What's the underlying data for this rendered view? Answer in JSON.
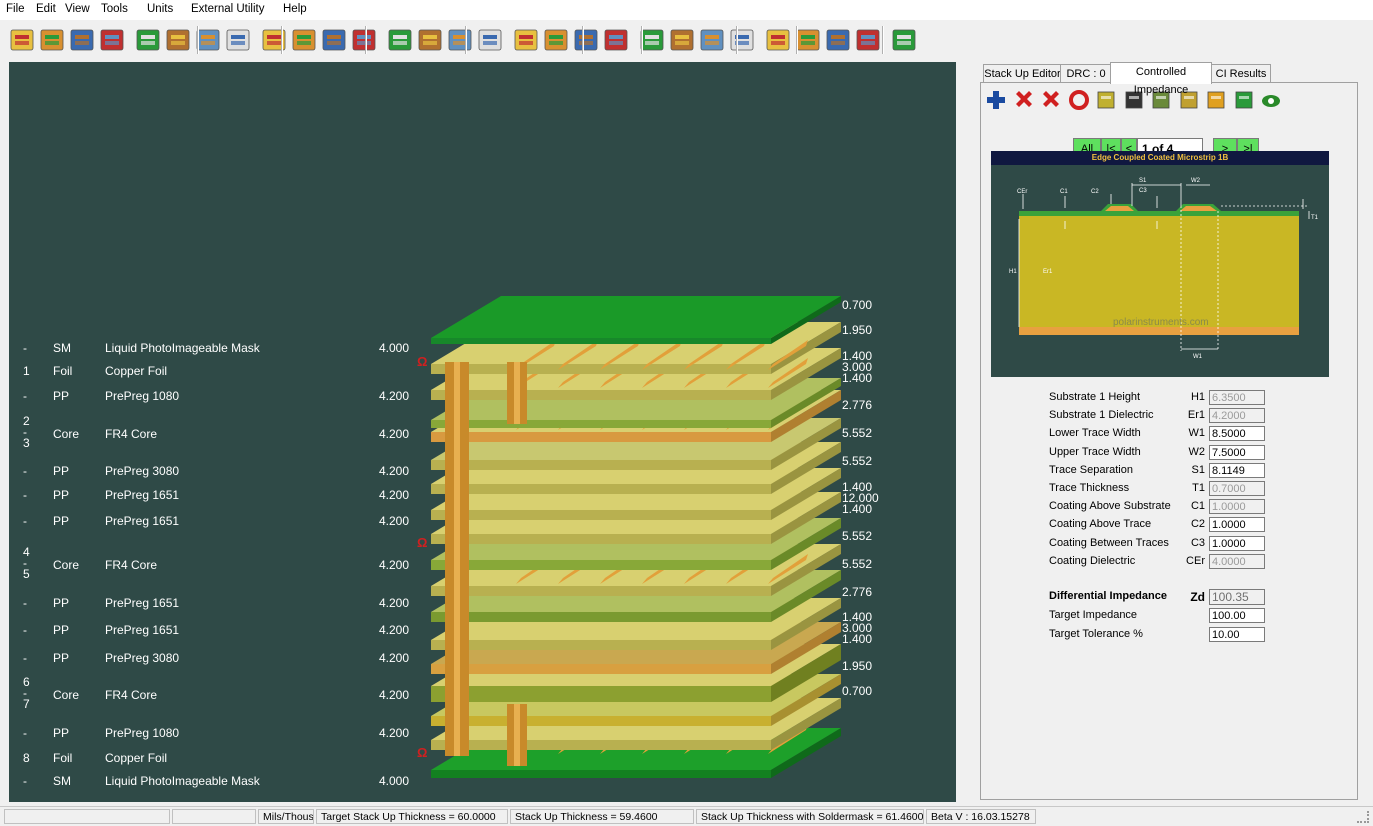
{
  "menu": [
    "File",
    "Edit",
    "View",
    "Tools",
    "Units",
    "External Utility",
    "Help"
  ],
  "tabs": [
    "Stack Up Editor",
    "DRC : 0",
    "Controlled Impedance",
    "CI Results"
  ],
  "nav": {
    "all": "All",
    "first": "|<",
    "prev": "<",
    "page": "1 of 4",
    "next": ">",
    "last": ">|"
  },
  "diagram": {
    "title": "Edge Coupled Coated Microstrip 1B",
    "watermark": "polarinstruments.com",
    "labels": {
      "s1": "S1",
      "w2": "W2",
      "c3": "C3",
      "cer": "CEr",
      "c1": "C1",
      "c2": "C2",
      "t1": "T1",
      "h1": "H1",
      "er1": "Er1",
      "w1": "W1"
    }
  },
  "layers": [
    {
      "num": "-",
      "type": "SM",
      "name": "Liquid PhotoImageable Mask",
      "er": "4.000"
    },
    {
      "num": "1",
      "type": "Foil",
      "name": "Copper Foil",
      "er": ""
    },
    {
      "num": "-",
      "type": "PP",
      "name": "PrePreg 1080",
      "er": "4.200"
    },
    {
      "num": "2\n-\n3",
      "type": "Core",
      "name": "FR4 Core",
      "er": "4.200"
    },
    {
      "num": "-",
      "type": "PP",
      "name": "PrePreg 3080",
      "er": "4.200"
    },
    {
      "num": "-",
      "type": "PP",
      "name": "PrePreg 1651",
      "er": "4.200"
    },
    {
      "num": "-",
      "type": "PP",
      "name": "PrePreg 1651",
      "er": "4.200"
    },
    {
      "num": "4\n-\n5",
      "type": "Core",
      "name": "FR4 Core",
      "er": "4.200"
    },
    {
      "num": "-",
      "type": "PP",
      "name": "PrePreg 1651",
      "er": "4.200"
    },
    {
      "num": "-",
      "type": "PP",
      "name": "PrePreg 1651",
      "er": "4.200"
    },
    {
      "num": "-",
      "type": "PP",
      "name": "PrePreg 3080",
      "er": "4.200"
    },
    {
      "num": "6\n-\n7",
      "type": "Core",
      "name": "FR4 Core",
      "er": "4.200"
    },
    {
      "num": "-",
      "type": "PP",
      "name": "PrePreg 1080",
      "er": "4.200"
    },
    {
      "num": "8",
      "type": "Foil",
      "name": "Copper Foil",
      "er": ""
    },
    {
      "num": "-",
      "type": "SM",
      "name": "Liquid PhotoImageable Mask",
      "er": "4.000"
    }
  ],
  "omega_symbol": "Ω",
  "thickness_labels": [
    "0.700",
    "1.950",
    "1.400",
    "3.000",
    "1.400",
    "2.776",
    "5.552",
    "5.552",
    "1.400",
    "12.000",
    "1.400",
    "5.552",
    "5.552",
    "2.776",
    "1.400",
    "3.000",
    "1.400",
    "1.950",
    "0.700"
  ],
  "fields": [
    {
      "label": "Substrate 1 Height",
      "sym": "H1",
      "value": "6.3500",
      "readonly": true
    },
    {
      "label": "Substrate 1 Dielectric",
      "sym": "Er1",
      "value": "4.2000",
      "readonly": true
    },
    {
      "label": "Lower Trace Width",
      "sym": "W1",
      "value": "8.5000",
      "readonly": false
    },
    {
      "label": "Upper Trace Width",
      "sym": "W2",
      "value": "7.5000",
      "readonly": false
    },
    {
      "label": "Trace Separation",
      "sym": "S1",
      "value": "8.1149",
      "readonly": false
    },
    {
      "label": "Trace Thickness",
      "sym": "T1",
      "value": "0.7000",
      "readonly": true
    },
    {
      "label": "Coating Above Substrate",
      "sym": "C1",
      "value": "1.0000",
      "readonly": true
    },
    {
      "label": "Coating Above Trace",
      "sym": "C2",
      "value": "1.0000",
      "readonly": false
    },
    {
      "label": "Coating Between Traces",
      "sym": "C3",
      "value": "1.0000",
      "readonly": false
    },
    {
      "label": "Coating Dielectric",
      "sym": "CEr",
      "value": "4.0000",
      "readonly": true
    }
  ],
  "impedance": {
    "label": "Differential Impedance",
    "sym": "Zd",
    "value": "100.35"
  },
  "target": {
    "impedance_label": "Target Impedance",
    "impedance": "100.00",
    "tolerance_label": "Target Tolerance %",
    "tolerance": "10.00"
  },
  "status": {
    "units": "Mils/Thous",
    "target": "Target Stack Up Thickness = 60.0000",
    "thickness": "Stack Up Thickness = 59.4600",
    "with_mask": "Stack Up Thickness with Soldermask = 61.4600",
    "beta": "Beta V : 16.03.15278"
  },
  "toolbar_icons": [
    "stackup-book-icon",
    "layer-manager-icon",
    "wizard-icon",
    "vitruvian-icon",
    "blank-page-icon",
    "add-layer-icon",
    "add-drill-icon",
    "delete-icon",
    "select-icon",
    "insert-pair-icon",
    "insert-layers-icon",
    "stack-icon",
    "notes-icon",
    "copy-icon",
    "paste-icon",
    "arrow-diag-1-icon",
    "arrow-diag-2-icon",
    "arrow-diag-3-icon",
    "arrow-diag-4-icon",
    "move-up-icon",
    "move-down-icon",
    "pcb-icon",
    "chip-icon",
    "2d-view-icon",
    "3d-view-icon",
    "building-icon",
    "report-icon",
    "report-graph-icon",
    "chart-icon"
  ],
  "ci_icons": [
    "add-icon",
    "delete-red-icon",
    "delete-all-icon",
    "refresh-icon",
    "calculator-icon",
    "blank-icon",
    "goal-seek-icon",
    "solder-icon",
    "report-yellow-icon",
    "insert-row-icon",
    "eye-icon"
  ],
  "colors": {
    "canvas": "#2f4a47",
    "green": "#1f9a2a",
    "yellow": "#d8d070",
    "copper": "#e2a03a",
    "nav": "#5ee05e"
  }
}
